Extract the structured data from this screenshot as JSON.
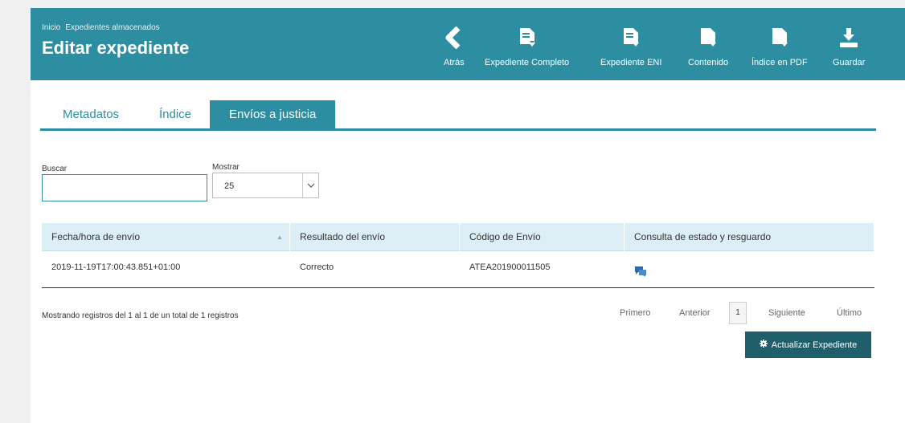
{
  "breadcrumb": [
    "Inicio",
    "Expedientes almacenados"
  ],
  "page_title": "Editar expediente",
  "toolbar": [
    {
      "label": "Atrás",
      "icon": "back-chevron-icon"
    },
    {
      "label": "Expediente Completo",
      "icon": "document-download-icon"
    },
    {
      "label": "Expediente ENI",
      "icon": "document-download-icon"
    },
    {
      "label": "Contenido",
      "icon": "file-download-icon"
    },
    {
      "label": "Índice en PDF",
      "icon": "file-download-icon"
    },
    {
      "label": "Guardar",
      "icon": "save-download-icon"
    }
  ],
  "tabs": [
    "Metadatos",
    "Índice",
    "Envíos a justicia"
  ],
  "active_tab": "Envíos a justicia",
  "search": {
    "label": "Buscar",
    "value": ""
  },
  "show": {
    "label": "Mostrar",
    "value": "25"
  },
  "table": {
    "columns": [
      "Fecha/hora de envío",
      "Resultado del envío",
      "Código de Envío",
      "Consulta de estado y resguardo"
    ],
    "rows": [
      [
        "2019-11-19T17:00:43.851+01:00",
        "Correcto",
        "ATEA201900011505",
        ""
      ]
    ]
  },
  "info_text": "Mostrando registros del 1 al 1 de un total de 1 registros",
  "pagination": {
    "first": "Primero",
    "previous": "Anterior",
    "current": "1",
    "next": "Siguiente",
    "last": "Último"
  },
  "update_button": "Actualizar Expediente",
  "colors": {
    "primary": "#2d8da1",
    "dark_button": "#1f5f6b",
    "table_header": "#dceef6"
  }
}
